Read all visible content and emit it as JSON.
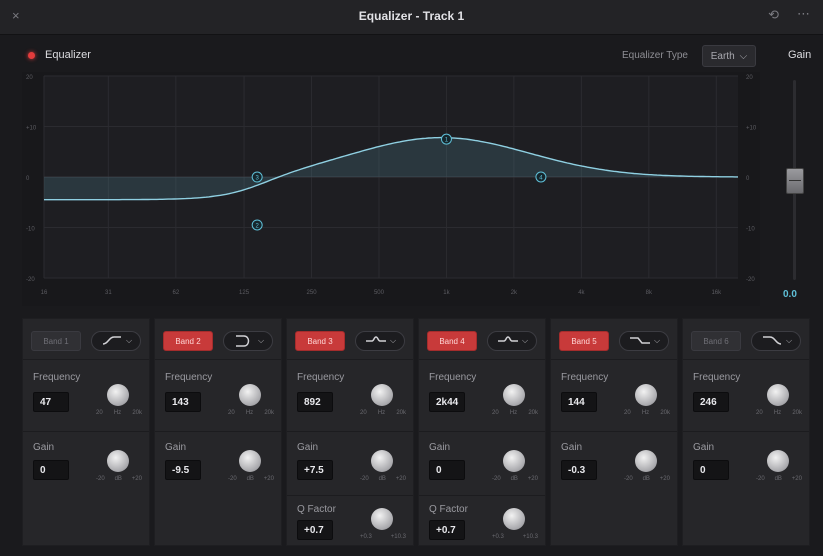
{
  "window": {
    "title": "Equalizer - Track 1",
    "close_icon": "×",
    "reset_icon": "⟲",
    "more_icon": "⋯"
  },
  "header": {
    "equalizer_label": "Equalizer",
    "type_label": "Equalizer Type",
    "type_value": "Earth",
    "type_chevron": "⌵",
    "gain_title": "Gain"
  },
  "graph": {
    "db_ticks_left": [
      "20",
      "+10",
      "0",
      "-10",
      "-20"
    ],
    "db_ticks_right": [
      "20",
      "+10",
      "0",
      "-10",
      "-20"
    ],
    "freq_ticks": [
      "16",
      "31",
      "62",
      "125",
      "250",
      "500",
      "1k",
      "2k",
      "4k",
      "8k",
      "16k"
    ],
    "curve_color": "#8fd0e2",
    "markers": [
      {
        "label": "1",
        "freq": 1000,
        "db": 7.5
      },
      {
        "label": "2",
        "freq": 143,
        "db": -9.5
      },
      {
        "label": "3",
        "freq": 143,
        "db": 0
      },
      {
        "label": "4",
        "freq": 2640,
        "db": 0
      }
    ]
  },
  "gain": {
    "value": "0.0",
    "level_db": 0
  },
  "bands": [
    {
      "name": "Band 1",
      "active": false,
      "shape": "low-shelf",
      "frequency_label": "Frequency",
      "frequency": "47",
      "freq_scale": [
        "20",
        "Hz",
        "20k"
      ],
      "gain_label": "Gain",
      "gain": "0",
      "gain_scale": [
        "-20",
        "dB",
        "+20"
      ]
    },
    {
      "name": "Band 2",
      "active": true,
      "shape": "low-cut",
      "frequency_label": "Frequency",
      "frequency": "143",
      "freq_scale": [
        "20",
        "Hz",
        "20k"
      ],
      "gain_label": "Gain",
      "gain": "-9.5",
      "gain_scale": [
        "-20",
        "dB",
        "+20"
      ]
    },
    {
      "name": "Band 3",
      "active": true,
      "shape": "bell",
      "frequency_label": "Frequency",
      "frequency": "892",
      "freq_scale": [
        "20",
        "Hz",
        "20k"
      ],
      "gain_label": "Gain",
      "gain": "+7.5",
      "gain_scale": [
        "-20",
        "dB",
        "+20"
      ],
      "q_label": "Q Factor",
      "q": "+0.7",
      "q_scale": [
        "+0.3",
        "",
        "+10.3"
      ]
    },
    {
      "name": "Band 4",
      "active": true,
      "shape": "bell",
      "frequency_label": "Frequency",
      "frequency": "2k44",
      "freq_scale": [
        "20",
        "Hz",
        "20k"
      ],
      "gain_label": "Gain",
      "gain": "0",
      "gain_scale": [
        "-20",
        "dB",
        "+20"
      ],
      "q_label": "Q Factor",
      "q": "+0.7",
      "q_scale": [
        "+0.3",
        "",
        "+10.3"
      ]
    },
    {
      "name": "Band 5",
      "active": true,
      "shape": "notch",
      "frequency_label": "Frequency",
      "frequency": "144",
      "freq_scale": [
        "20",
        "Hz",
        "20k"
      ],
      "gain_label": "Gain",
      "gain": "-0.3",
      "gain_scale": [
        "-20",
        "dB",
        "+20"
      ]
    },
    {
      "name": "Band 6",
      "active": false,
      "shape": "high-shelf",
      "frequency_label": "Frequency",
      "frequency": "246",
      "freq_scale": [
        "20",
        "Hz",
        "20k"
      ],
      "gain_label": "Gain",
      "gain": "0",
      "gain_scale": [
        "-20",
        "dB",
        "+20"
      ]
    }
  ]
}
